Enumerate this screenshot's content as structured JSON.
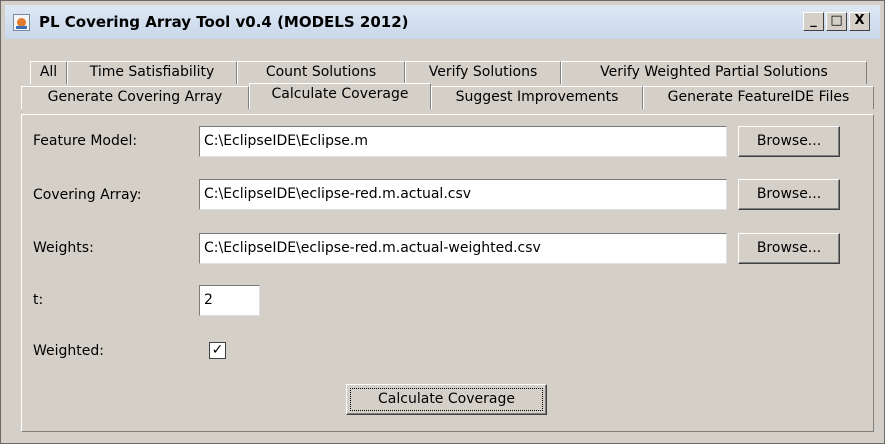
{
  "window": {
    "title": "PL Covering Array Tool v0.4 (MODELS 2012)",
    "controls": [
      "_",
      "□",
      "X"
    ]
  },
  "tabs_row1": [
    {
      "label": "All"
    },
    {
      "label": "Time Satisfiability"
    },
    {
      "label": "Count Solutions"
    },
    {
      "label": "Verify Solutions"
    },
    {
      "label": "Verify Weighted Partial Solutions"
    }
  ],
  "tabs_row2": [
    {
      "label": "Generate Covering Array"
    },
    {
      "label": "Calculate Coverage",
      "selected": true
    },
    {
      "label": "Suggest Improvements"
    },
    {
      "label": "Generate FeatureIDE Files"
    }
  ],
  "form": {
    "feature_model": {
      "label": "Feature Model:",
      "value": "C:\\EclipseIDE\\Eclipse.m",
      "button": "Browse..."
    },
    "covering_array": {
      "label": "Covering Array:",
      "value": "C:\\EclipseIDE\\eclipse-red.m.actual.csv",
      "button": "Browse..."
    },
    "weights": {
      "label": "Weights:",
      "value": "C:\\EclipseIDE\\eclipse-red.m.actual-weighted.csv",
      "button": "Browse..."
    },
    "t": {
      "label": "t:",
      "value": "2"
    },
    "weighted": {
      "label": "Weighted:",
      "checked": true,
      "mark": "✓"
    },
    "action_button": "Calculate Coverage"
  }
}
